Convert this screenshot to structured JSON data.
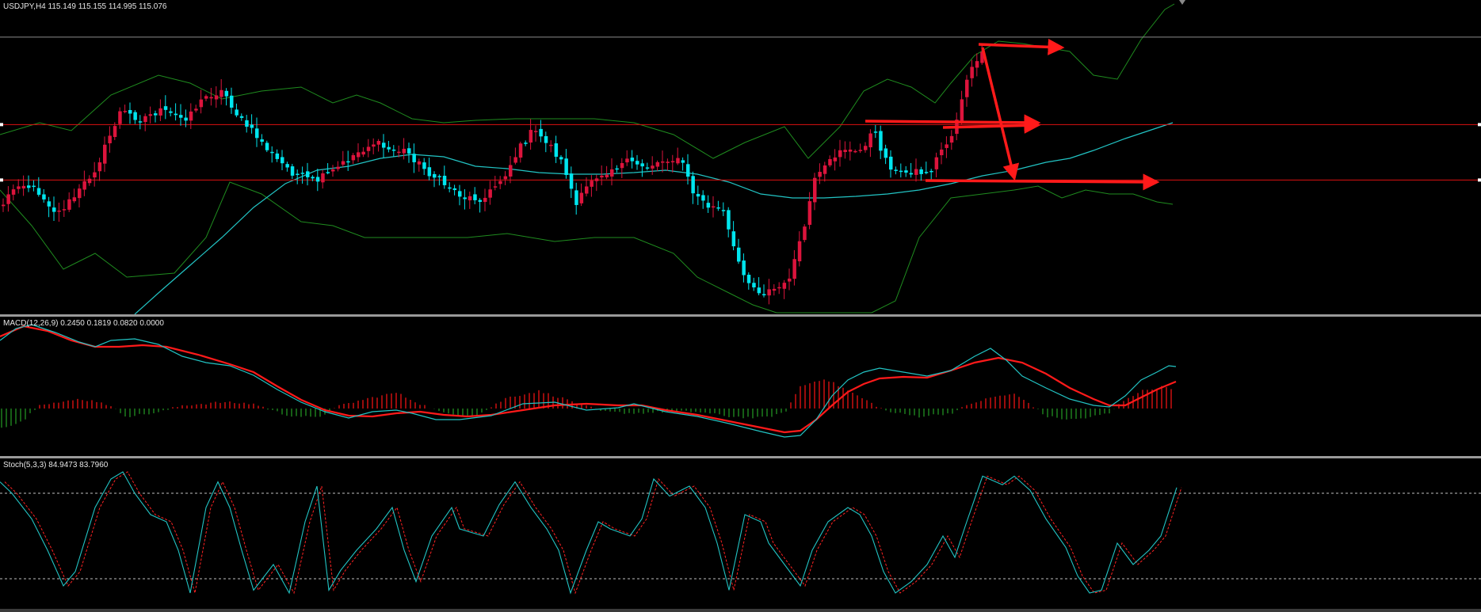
{
  "chart_data": [
    {
      "type": "candlestick",
      "header": "USDJPY,H4  115.149 115.155 114.995 115.076",
      "symbol": "USDJPY",
      "timeframe": "H4",
      "ohlc_readout": [
        115.149,
        115.155,
        114.995,
        115.076
      ],
      "ylim": [
        110.5,
        116.0
      ],
      "colors": {
        "bull": "#dc143c",
        "bear": "#00e5ee",
        "bands": "#1f8c1f",
        "ma": "#22c4c4",
        "hline": "#dd1111",
        "arrow": "#ff1a1a",
        "grid": "#8c8c8c"
      },
      "horizontal_levels": [
        115.35,
        113.82,
        112.85
      ],
      "bands_and_ma": true,
      "arrows_drawn": 5
    },
    {
      "type": "macd",
      "header": "MACD(12,26,9) 0.2450 0.1819 0.0820 0.0000",
      "params": "12,26,9",
      "values": [
        0.245,
        0.1819,
        0.082,
        0.0
      ],
      "colors": {
        "line": "#ff1a1a",
        "signal": "#22c4c4",
        "hist_up": "#cc1111",
        "hist_down": "#1e7d1e"
      }
    },
    {
      "type": "stochastic",
      "header": "Stoch(5,3,3) 84.9473 83.7960",
      "params": "5,3,3",
      "values": [
        84.9473,
        83.796
      ],
      "levels": [
        80,
        20
      ],
      "ylim": [
        0,
        100
      ],
      "colors": {
        "k": "#22c4c4",
        "d": "#ff2222",
        "level": "#bfbfbf"
      }
    }
  ]
}
